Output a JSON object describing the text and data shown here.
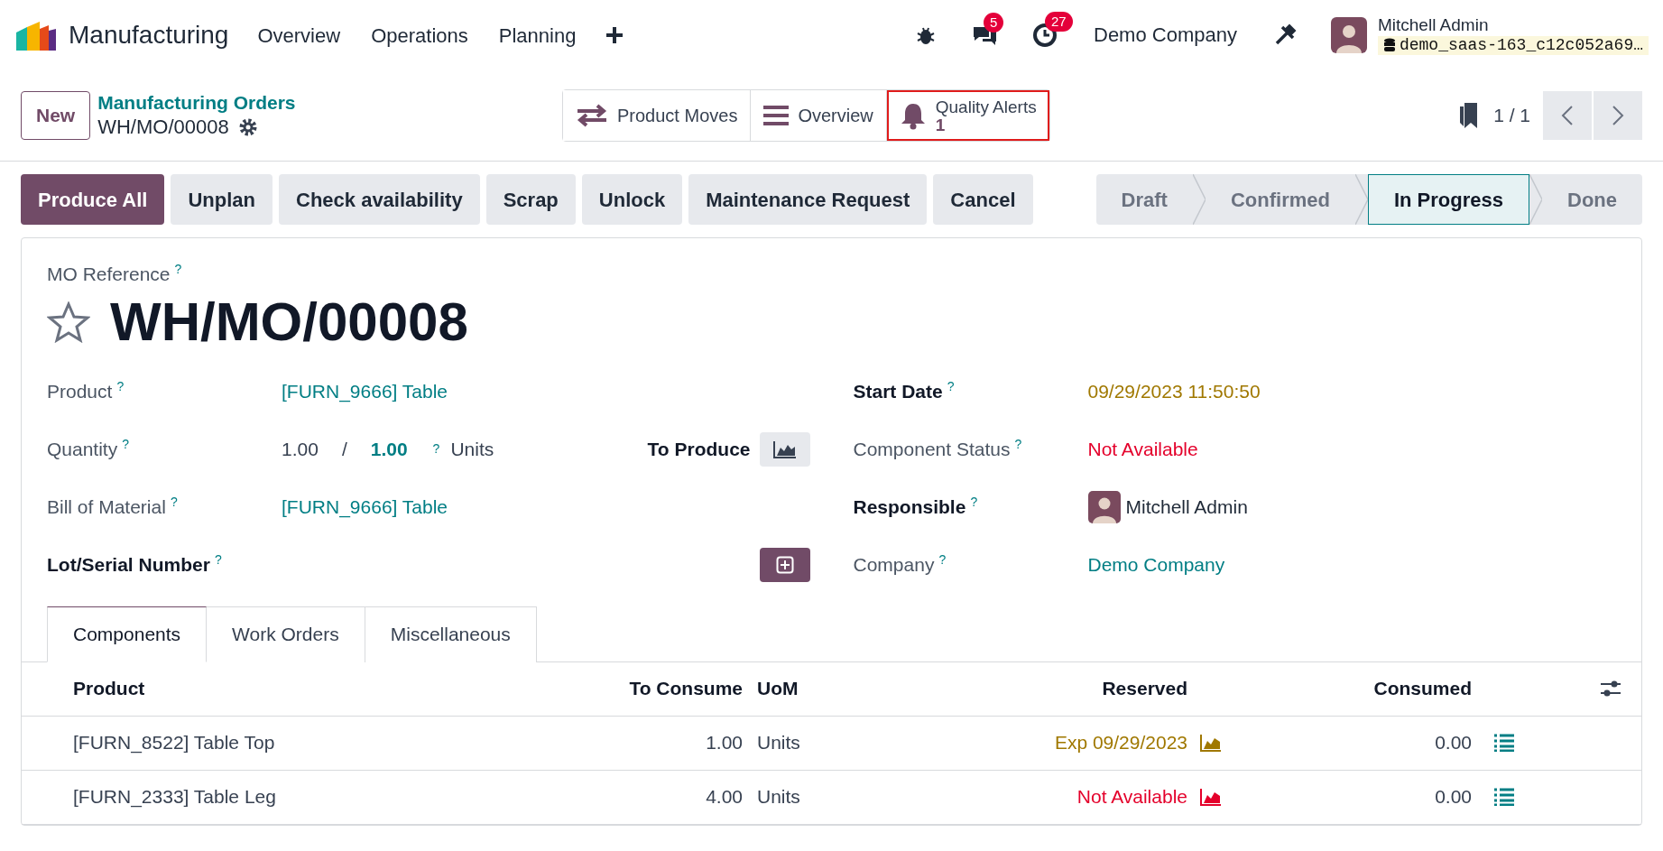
{
  "navbar": {
    "app": "Manufacturing",
    "menus": [
      "Overview",
      "Operations",
      "Planning"
    ],
    "messages_count": "5",
    "activities_count": "27",
    "company": "Demo Company",
    "user": "Mitchell Admin",
    "database": "demo_saas-163_c12c052a69…"
  },
  "control_panel": {
    "new_button": "New",
    "breadcrumb_parent": "Manufacturing Orders",
    "breadcrumb_current": "WH/MO/00008",
    "pager": "1 / 1"
  },
  "smart_buttons": [
    {
      "kind": "moves",
      "label": "Product Moves",
      "highlighted": false
    },
    {
      "kind": "overview",
      "label": "Overview",
      "highlighted": false
    },
    {
      "kind": "alerts",
      "label": "Quality Alerts",
      "value": "1",
      "highlighted": true
    }
  ],
  "actions": [
    {
      "label": "Produce All",
      "primary": true
    },
    {
      "label": "Unplan",
      "primary": false
    },
    {
      "label": "Check availability",
      "primary": false
    },
    {
      "label": "Scrap",
      "primary": false
    },
    {
      "label": "Unlock",
      "primary": false
    },
    {
      "label": "Maintenance Request",
      "primary": false
    },
    {
      "label": "Cancel",
      "primary": false
    }
  ],
  "stages": [
    {
      "label": "Draft",
      "selected": false
    },
    {
      "label": "Confirmed",
      "selected": false
    },
    {
      "label": "In Progress",
      "selected": true
    },
    {
      "label": "Done",
      "selected": false
    }
  ],
  "form": {
    "reference_label": "MO Reference",
    "reference_help": "?",
    "title": "WH/MO/00008",
    "starred": false,
    "left_fields": [
      {
        "kind": "link",
        "label": "Product",
        "help": "?",
        "bold": false,
        "value": "[FURN_9666] Table"
      },
      {
        "kind": "quantity",
        "label": "Quantity",
        "help": "?",
        "bold": false,
        "value": "1.00",
        "separator": "/",
        "target": "1.00",
        "target_help": "?",
        "uom": "Units",
        "extra_label": "To Produce"
      },
      {
        "kind": "link",
        "label": "Bill of Material",
        "help": "?",
        "bold": false,
        "value": "[FURN_9666] Table"
      },
      {
        "kind": "lot",
        "label": "Lot/Serial Number",
        "help": "?",
        "bold": true
      }
    ],
    "right_fields": [
      {
        "kind": "date",
        "label": "Start Date",
        "help": "?",
        "bold": true,
        "value": "09/29/2023 11:50:50"
      },
      {
        "kind": "danger",
        "label": "Component Status",
        "help": "?",
        "bold": false,
        "value": "Not Available"
      },
      {
        "kind": "user",
        "label": "Responsible",
        "help": "?",
        "bold": true,
        "value": "Mitchell Admin"
      },
      {
        "kind": "link",
        "label": "Company",
        "help": "?",
        "bold": false,
        "value": "Demo Company"
      }
    ]
  },
  "tabs": [
    {
      "label": "Components",
      "selected": true
    },
    {
      "label": "Work Orders",
      "selected": false
    },
    {
      "label": "Miscellaneous",
      "selected": false
    }
  ],
  "table": {
    "columns": [
      "Product",
      "To Consume",
      "UoM",
      "Reserved",
      "Consumed"
    ],
    "rows": [
      {
        "product": "[FURN_8522] Table Top",
        "to_consume": "1.00",
        "uom": "Units",
        "reserved": "Exp 09/29/2023",
        "kind": "expected",
        "consumed": "0.00"
      },
      {
        "product": "[FURN_2333] Table Leg",
        "to_consume": "4.00",
        "uom": "Units",
        "reserved": "Not Available",
        "kind": "unavailable",
        "consumed": "0.00"
      }
    ]
  }
}
